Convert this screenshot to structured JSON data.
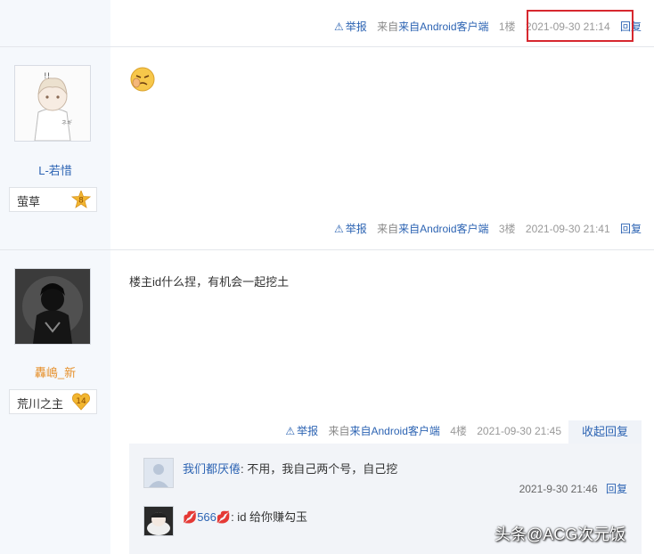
{
  "posts": [
    {
      "tail": {
        "report": "举报",
        "source": "来自Android客户端",
        "floor": "1楼",
        "time": "2021-09-30 21:14",
        "reply": "回复"
      }
    },
    {
      "author": {
        "name": "L-若惜",
        "level_name": "萤草",
        "level": "8"
      },
      "content": "[emoji]",
      "tail": {
        "report": "举报",
        "source": "来自Android客户端",
        "floor": "3楼",
        "time": "2021-09-30 21:41",
        "reply": "回复"
      }
    },
    {
      "author": {
        "name": "轟嶋_新",
        "level_name": "荒川之主",
        "level": "14"
      },
      "content": "楼主id什么捏，有机会一起挖土",
      "tail": {
        "report": "举报",
        "source": "来自Android客户端",
        "floor": "4楼",
        "time": "2021-09-30 21:45",
        "reply": "收起回复"
      }
    }
  ],
  "sub_replies": [
    {
      "name": "我们都厌倦",
      "text": ": 不用，我自己两个号，自己挖",
      "time": "2021-9-30 21:46",
      "reply": "回复"
    },
    {
      "name": "566",
      "text": ": id 给你赚勾玉"
    }
  ],
  "watermark": "头条@ACG次元饭",
  "colors": {
    "link": "#2d64b3",
    "highlight_box": "#d7282f",
    "sidebar": "#f5f8fc",
    "level_gold": "#f2b630"
  }
}
